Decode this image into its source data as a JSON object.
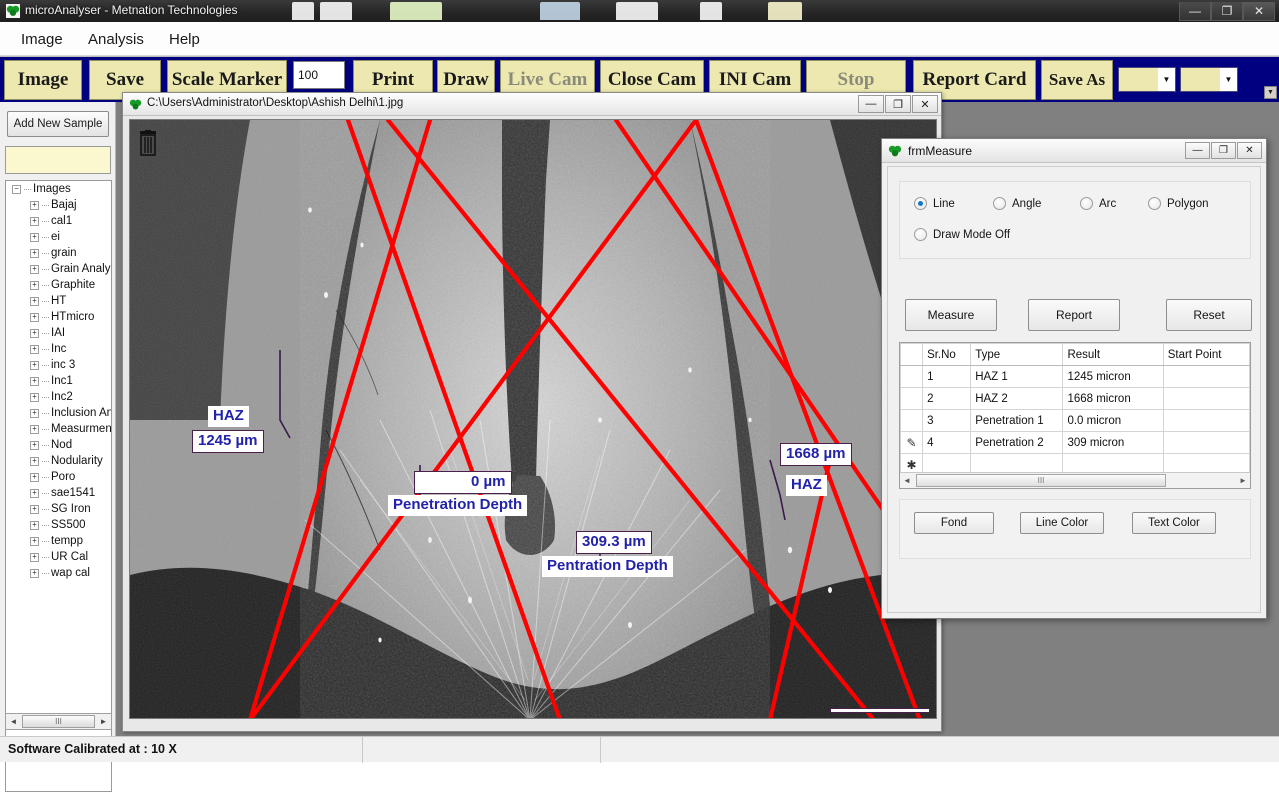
{
  "app": {
    "title": "microAnalyser - Metnation Technologies",
    "window_buttons": {
      "minimize": "—",
      "restore": "❐",
      "close": "✕"
    }
  },
  "menu": {
    "items": [
      {
        "label": "Image"
      },
      {
        "label": "Analysis"
      },
      {
        "label": "Help"
      }
    ]
  },
  "toolbar": {
    "buttons": [
      {
        "label": "Image",
        "disabled": false
      },
      {
        "label": "Save",
        "disabled": false
      },
      {
        "label": "Scale Marker",
        "disabled": false
      },
      {
        "label": "Print",
        "disabled": false
      },
      {
        "label": "Draw",
        "disabled": false
      },
      {
        "label": "Live Cam",
        "disabled": true
      },
      {
        "label": "Close Cam",
        "disabled": false
      },
      {
        "label": "INI Cam",
        "disabled": false
      },
      {
        "label": "Stop",
        "disabled": true
      },
      {
        "label": "Report Card",
        "disabled": false
      },
      {
        "label": "Save As",
        "disabled": false
      }
    ],
    "scale_value": "100",
    "combo1_value": "",
    "combo2_value": "",
    "scroll_down_icon": "▼"
  },
  "left_panel": {
    "add_sample_label": "Add New Sample",
    "sample_name_value": "",
    "tree": {
      "root": {
        "label": "Images",
        "expander": "−"
      },
      "children": [
        {
          "label": "Bajaj"
        },
        {
          "label": "cal1"
        },
        {
          "label": "ei"
        },
        {
          "label": "grain"
        },
        {
          "label": "Grain Analysis"
        },
        {
          "label": "Graphite"
        },
        {
          "label": "HT"
        },
        {
          "label": "HTmicro"
        },
        {
          "label": "IAI"
        },
        {
          "label": "Inc"
        },
        {
          "label": "inc 3"
        },
        {
          "label": "Inc1"
        },
        {
          "label": "Inc2"
        },
        {
          "label": "Inclusion Analy"
        },
        {
          "label": "Measurment"
        },
        {
          "label": "Nod"
        },
        {
          "label": "Nodularity"
        },
        {
          "label": "Poro"
        },
        {
          "label": "sae1541"
        },
        {
          "label": "SG Iron"
        },
        {
          "label": "SS500"
        },
        {
          "label": "tempp"
        },
        {
          "label": "UR Cal"
        },
        {
          "label": "wap cal"
        }
      ],
      "expander_child": "+"
    },
    "hscroll": {
      "left": "◄",
      "right": "►",
      "grip": "III"
    }
  },
  "image_window": {
    "title": "C:\\Users\\Administrator\\Desktop\\Ashish Delhi\\1.jpg",
    "window_buttons": {
      "minimize": "—",
      "restore": "❐",
      "close": "✕"
    },
    "trash_icon_name": "trash-icon",
    "annotations": [
      {
        "id": "haz-left-label",
        "text": "HAZ"
      },
      {
        "id": "haz-left-value",
        "text": "1245 µm"
      },
      {
        "id": "pen-depth-1-value",
        "text": "0 µm"
      },
      {
        "id": "pen-depth-1-label",
        "text": "Penetration Depth"
      },
      {
        "id": "pen-depth-2-value",
        "text": "309.3 µm"
      },
      {
        "id": "pen-depth-2-label",
        "text": "Pentration Depth"
      },
      {
        "id": "haz-right-value",
        "text": "1668 µm"
      },
      {
        "id": "haz-right-label",
        "text": "HAZ"
      }
    ]
  },
  "frm_measure": {
    "title": "frmMeasure",
    "window_buttons": {
      "minimize": "—",
      "restore": "❐",
      "close": "✕"
    },
    "modes": [
      {
        "label": "Line",
        "selected": true
      },
      {
        "label": "Angle",
        "selected": false
      },
      {
        "label": "Arc",
        "selected": false
      },
      {
        "label": "Polygon",
        "selected": false
      },
      {
        "label": "Draw Mode Off",
        "selected": false
      }
    ],
    "action_buttons": [
      {
        "label": "Measure"
      },
      {
        "label": "Report"
      },
      {
        "label": "Reset"
      }
    ],
    "grid": {
      "columns": [
        "Sr.No",
        "Type",
        "Result",
        "Start Point"
      ],
      "rows": [
        {
          "marker": "",
          "sr": "1",
          "type": "HAZ 1",
          "result": "1245 micron",
          "start": ""
        },
        {
          "marker": "",
          "sr": "2",
          "type": "HAZ 2",
          "result": "1668 micron",
          "start": ""
        },
        {
          "marker": "",
          "sr": "3",
          "type": "Penetration 1",
          "result": "0.0 micron",
          "start": ""
        },
        {
          "marker": "✎",
          "sr": "4",
          "type": "Penetration 2",
          "result": "309 micron",
          "start": ""
        },
        {
          "marker": "✱",
          "sr": "",
          "type": "",
          "result": "",
          "start": ""
        }
      ],
      "hscroll": {
        "left": "◄",
        "right": "►",
        "grip": "III"
      }
    },
    "style_buttons": [
      {
        "label": "Fond"
      },
      {
        "label": "Line Color"
      },
      {
        "label": "Text Color"
      }
    ]
  },
  "status_bar": {
    "text": "Software Calibrated at :  10  X"
  },
  "colors": {
    "toolbar_bg": "#000080",
    "toolbar_button": "#ece8b0",
    "annotation_text": "#2222aa",
    "measure_line": "#ff0000",
    "annotation_border": "#4b1f4b"
  }
}
